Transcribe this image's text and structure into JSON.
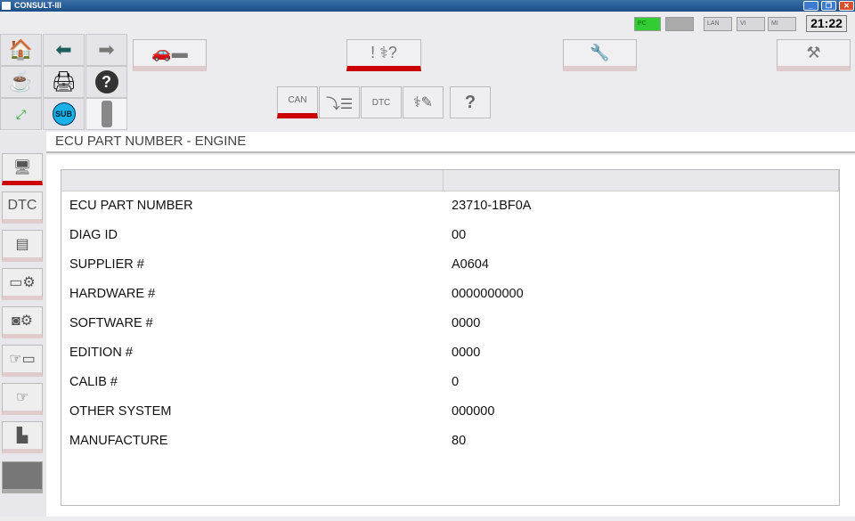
{
  "window": {
    "title": "CONSULT-III"
  },
  "status": {
    "pc": "PC",
    "lan": "LAN",
    "vi": "VI",
    "mi": "MI",
    "time": "21:22"
  },
  "toolbar": {
    "sub": "SUB",
    "can": "CAN",
    "dtc": "DTC"
  },
  "header": {
    "title": "ECU PART NUMBER - ENGINE"
  },
  "table": {
    "rows": [
      {
        "label": "ECU PART NUMBER",
        "value": "23710-1BF0A"
      },
      {
        "label": "DIAG ID",
        "value": "00"
      },
      {
        "label": "SUPPLIER #",
        "value": "A0604"
      },
      {
        "label": "HARDWARE #",
        "value": "0000000000"
      },
      {
        "label": "SOFTWARE #",
        "value": "0000"
      },
      {
        "label": "EDITION #",
        "value": "0000"
      },
      {
        "label": "CALIB #",
        "value": "0"
      },
      {
        "label": "OTHER SYSTEM",
        "value": "000000"
      },
      {
        "label": "MANUFACTURE",
        "value": "80"
      }
    ]
  }
}
